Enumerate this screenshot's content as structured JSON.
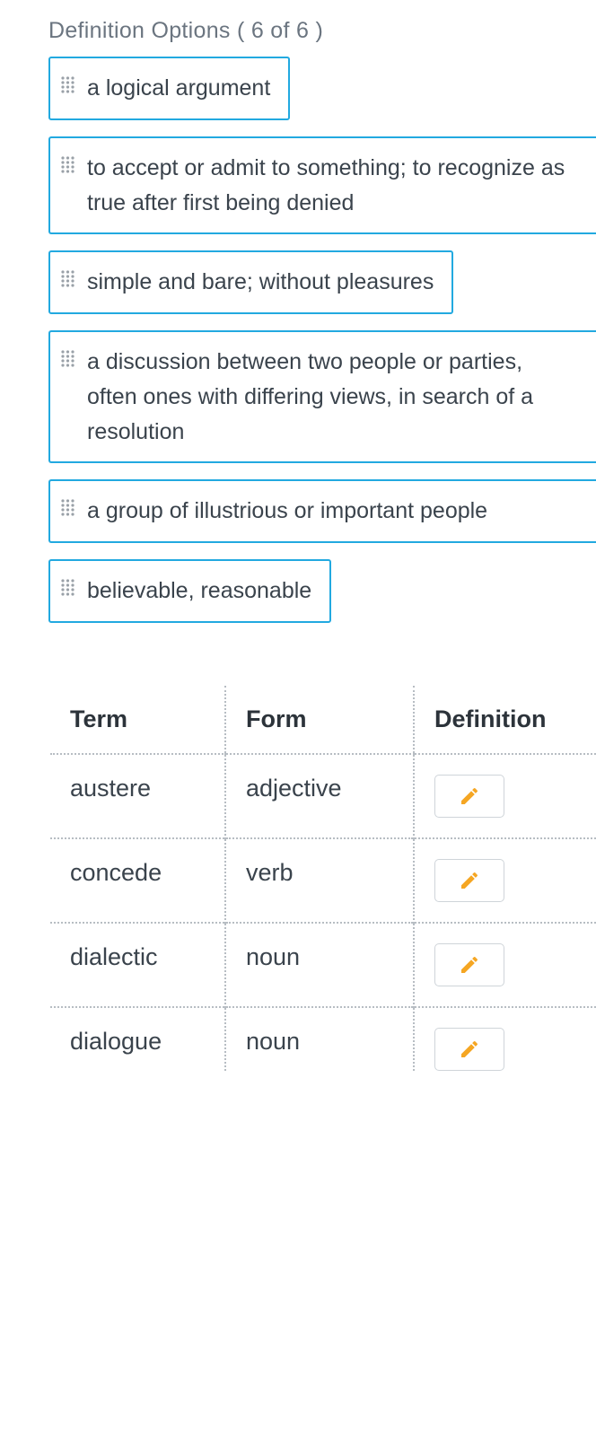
{
  "header": {
    "title": "Definition Options ( 6 of 6 )"
  },
  "options": [
    {
      "text": "a logical argument",
      "full": false
    },
    {
      "text": "to accept or admit to something; to recognize as true after first being denied",
      "full": true
    },
    {
      "text": "simple and bare; without pleasures",
      "full": false
    },
    {
      "text": "a discussion between two people or parties, often ones with differing views, in search of a resolution",
      "full": true
    },
    {
      "text": "a group of illustrious or important people",
      "full": true
    },
    {
      "text": "believable, reasonable",
      "full": false
    }
  ],
  "table": {
    "headers": {
      "term": "Term",
      "form": "Form",
      "definition": "Definition"
    },
    "rows": [
      {
        "term": "austere",
        "form": "adjective"
      },
      {
        "term": "concede",
        "form": "verb"
      },
      {
        "term": "dialectic",
        "form": "noun"
      },
      {
        "term": "dialogue",
        "form": "noun"
      }
    ]
  },
  "icons": {
    "drag": "drag-handle-icon",
    "edit": "pencil-icon"
  },
  "colors": {
    "accent": "#22a9e0",
    "edit_icon": "#f5a623",
    "dotted_border": "#b7bdc3"
  }
}
